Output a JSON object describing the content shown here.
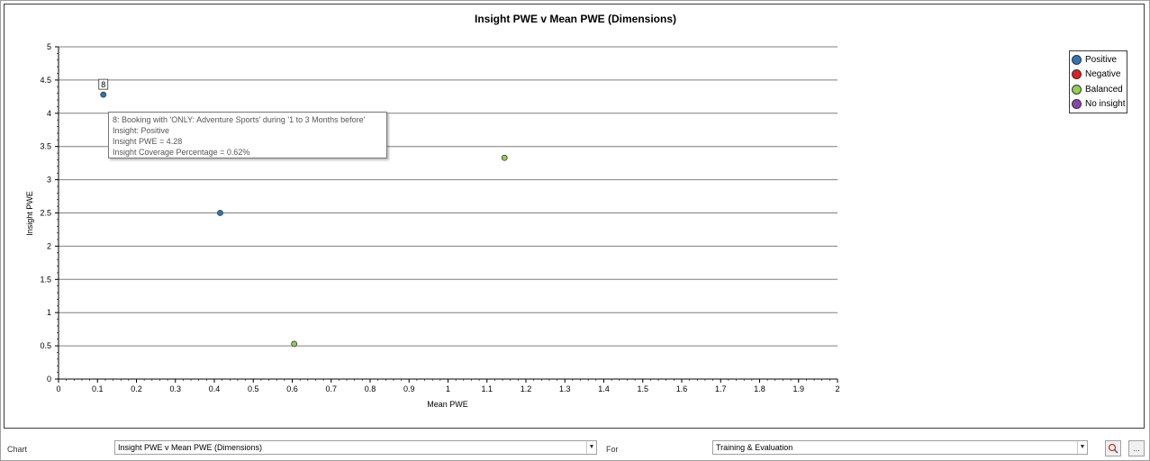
{
  "chart_data": {
    "type": "scatter",
    "title": "Insight PWE v Mean PWE (Dimensions)",
    "xlabel": "Mean PWE",
    "ylabel": "Insight PWE",
    "xlim": [
      0,
      2
    ],
    "ylim": [
      0,
      5
    ],
    "xticks": [
      "0",
      "0.1",
      "0.2",
      "0.3",
      "0.4",
      "0.5",
      "0.6",
      "0.7",
      "0.8",
      "0.9",
      "1",
      "1.1",
      "1.2",
      "1.3",
      "1.4",
      "1.5",
      "1.6",
      "1.7",
      "1.8",
      "1.9",
      "2"
    ],
    "yticks": [
      "0",
      "0.5",
      "1",
      "1.5",
      "2",
      "2.5",
      "3",
      "3.5",
      "4",
      "4.5",
      "5"
    ],
    "grid": "horizontal",
    "legend_position": "right",
    "series": [
      {
        "name": "Positive",
        "color": "#2e75b6",
        "points": [
          {
            "x": 0.115,
            "y": 4.28,
            "label": "8"
          },
          {
            "x": 0.415,
            "y": 2.5
          }
        ]
      },
      {
        "name": "Negative",
        "color": "#e02020",
        "points": []
      },
      {
        "name": "Balanced",
        "color": "#92d050",
        "points": [
          {
            "x": 1.145,
            "y": 3.33
          },
          {
            "x": 0.605,
            "y": 0.53
          }
        ]
      },
      {
        "name": "No insight",
        "color": "#8e44ad",
        "points": []
      }
    ]
  },
  "tooltip": {
    "line1": "8: Booking with 'ONLY: Adventure Sports' during '1 to 3 Months before'",
    "line2": "Insight: Positive",
    "line3": "Insight PWE = 4.28",
    "line4": "Insight Coverage Percentage = 0.62%"
  },
  "controls": {
    "chart_label": "Chart",
    "chart_value": "Insight PWE v Mean PWE (Dimensions)",
    "for_label": "For",
    "for_value": "Training & Evaluation",
    "more_label": "..."
  }
}
